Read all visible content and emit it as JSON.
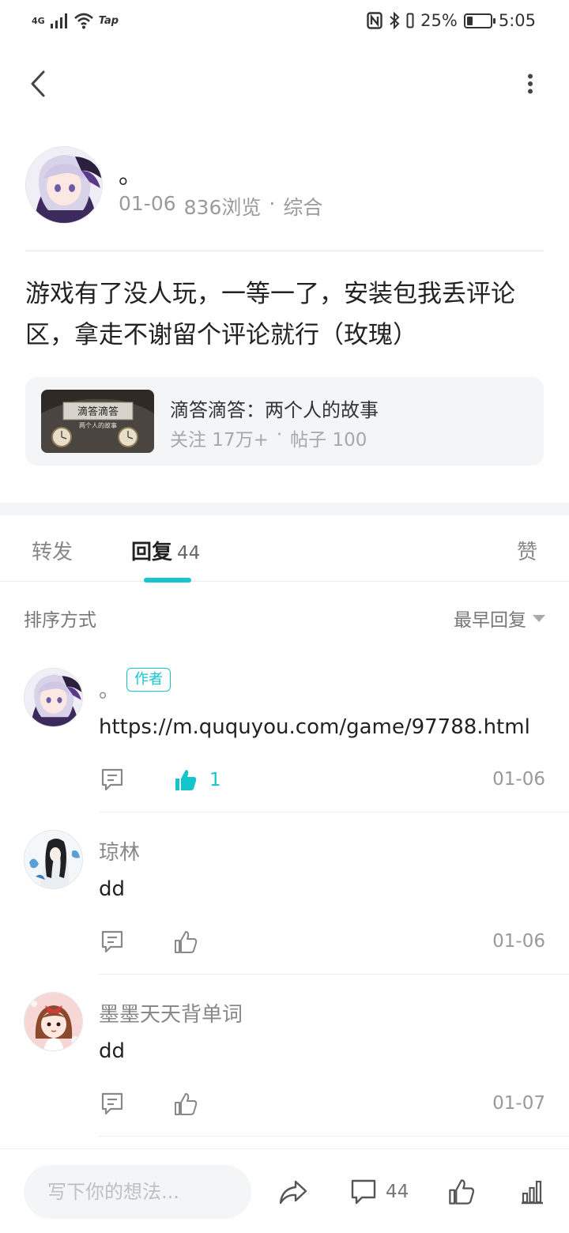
{
  "status_bar": {
    "network": "4G",
    "app_tag": "Tap",
    "battery": "25%",
    "battery_level": 0.25,
    "time": "5:05"
  },
  "post": {
    "author_name": "。",
    "date": "01-06",
    "views": "836浏览",
    "separator": "·",
    "category": "综合",
    "content": "游戏有了没人玩，一等一了，安装包我丢评论区，拿走不谢留个评论就行（玫瑰）"
  },
  "game_card": {
    "title": "滴答滴答：两个人的故事",
    "followers": "关注 17万+",
    "separator": "·",
    "posts": "帖子 100",
    "thumb_title": "滴答滴答",
    "thumb_subtitle": "两个人的故事"
  },
  "tabs": {
    "forward": "转发",
    "reply": "回复",
    "reply_count": "44",
    "like": "赞"
  },
  "sort": {
    "label": "排序方式",
    "value": "最早回复"
  },
  "comments": [
    {
      "name": "。",
      "badge": "作者",
      "text": "https://m.ququyou.com/game/97788.html",
      "likes": "1",
      "date": "01-06"
    },
    {
      "name": "琼林",
      "text": "dd",
      "date": "01-06"
    },
    {
      "name": "墨墨天天背单词",
      "text": "dd",
      "date": "01-07"
    }
  ],
  "bottom_bar": {
    "input_placeholder": "写下你的想法...",
    "comment_count": "44"
  },
  "colors": {
    "accent": "#15c5ce",
    "text_primary": "#222222",
    "text_secondary": "#999999",
    "card_bg": "#f4f5f7"
  }
}
